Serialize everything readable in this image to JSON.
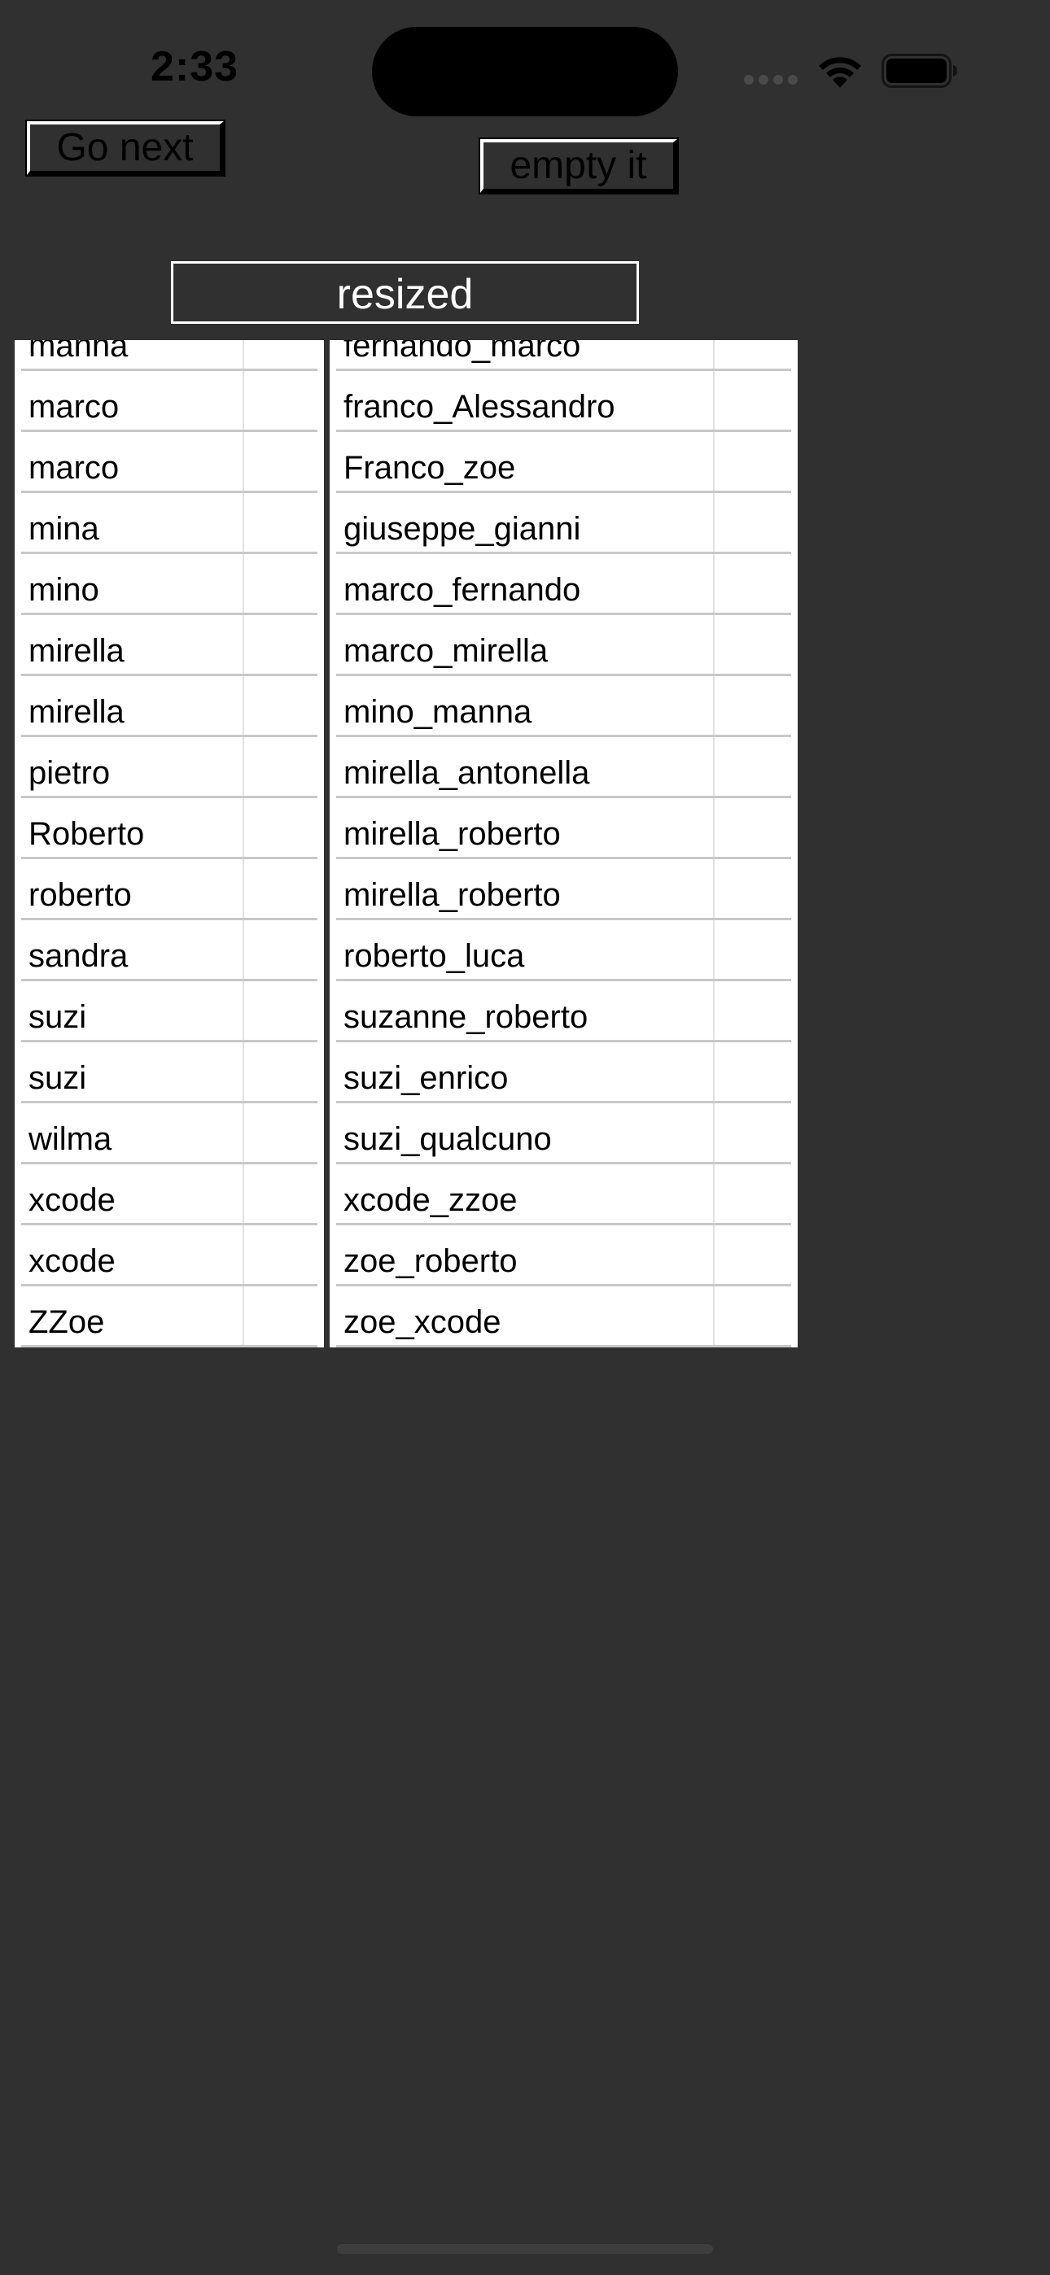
{
  "status_bar": {
    "time": "2:33"
  },
  "toolbar": {
    "go_next_label": "Go next",
    "empty_it_label": "empty it"
  },
  "header": {
    "resized_label": "resized"
  },
  "left_table": {
    "rows": [
      "manna",
      "marco",
      "marco",
      "mina",
      "mino",
      "mirella",
      "mirella",
      "pietro",
      "Roberto",
      "roberto",
      "sandra",
      "suzi",
      "suzi",
      "wilma",
      "xcode",
      "xcode",
      "ZZoe"
    ]
  },
  "right_table": {
    "rows": [
      "fernando_marco",
      "franco_Alessandro",
      "Franco_zoe",
      "giuseppe_gianni",
      "marco_fernando",
      "marco_mirella",
      "mino_manna",
      "mirella_antonella",
      "mirella_roberto",
      "mirella_roberto",
      "roberto_luca",
      "suzanne_roberto",
      "suzi_enrico",
      "suzi_qualcuno",
      "xcode_zzoe",
      "zoe_roberto",
      "zoe_xcode"
    ]
  },
  "colors": {
    "background": "#303030",
    "table_background": "#ffffff",
    "divider": "#c8c8c8"
  },
  "icons": [
    "signal-icon",
    "wifi-icon",
    "battery-icon"
  ]
}
